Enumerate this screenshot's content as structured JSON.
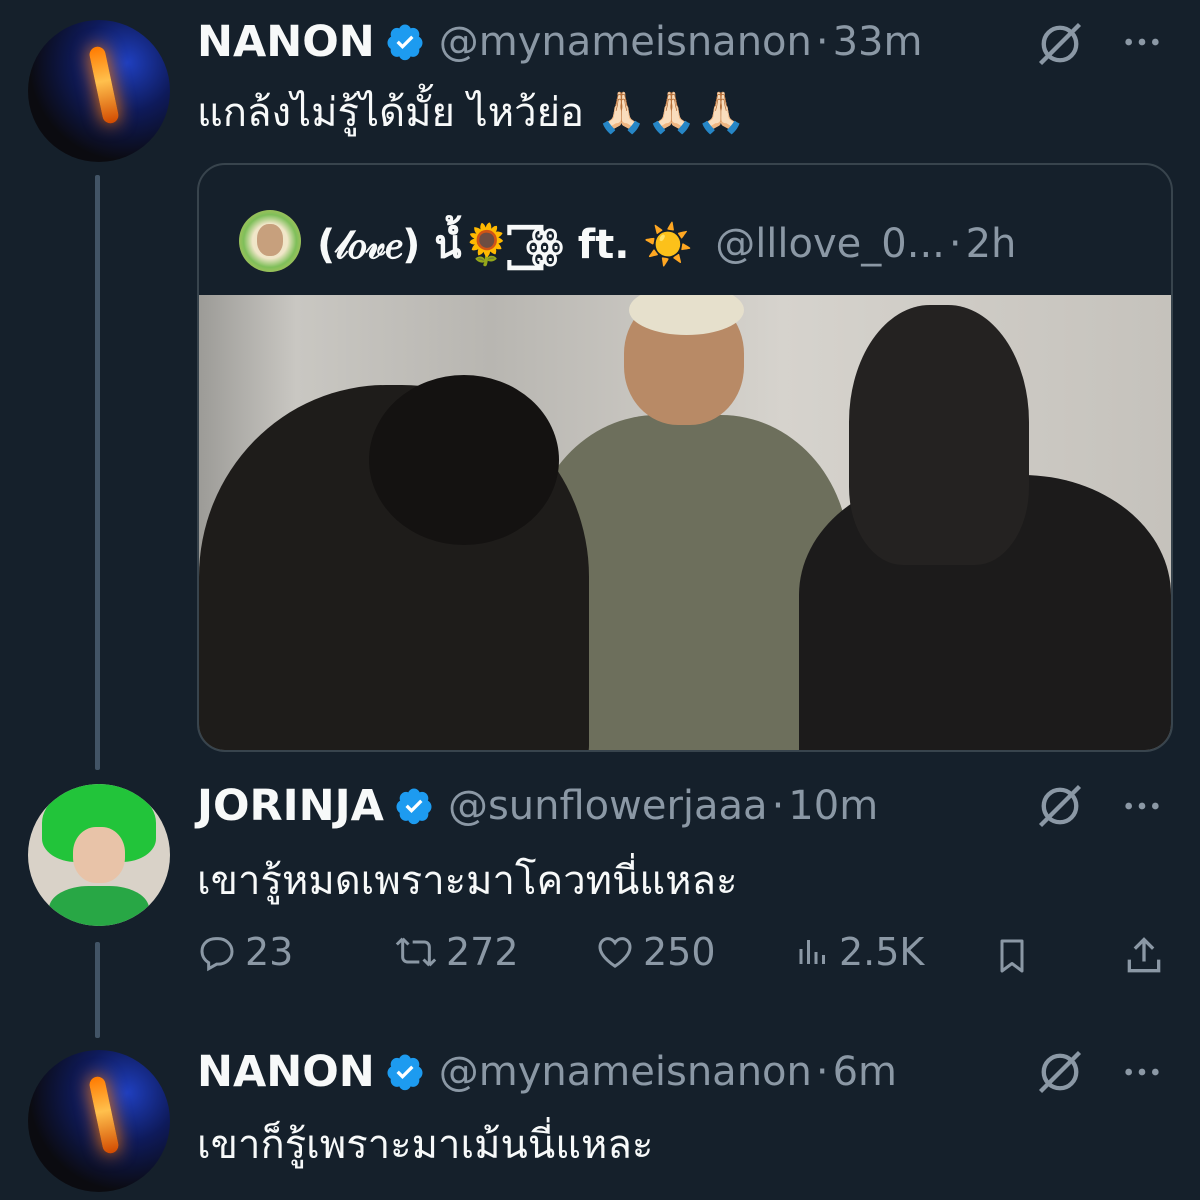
{
  "colors": {
    "background": "#15202b",
    "verified": "#1d9bf0",
    "muted": "#8b98a5",
    "text": "#f7f9f9"
  },
  "tweets": [
    {
      "name": "NANON",
      "handle": "@mynameisnanon",
      "time": "33m",
      "text": "แกล้งไม่รู้ได้มั้ย ไหว้ย่อ 🙏🏻🙏🏻🙏🏻",
      "quote": {
        "name": "(𝓁𝑜𝓋𝑒) นํ้🌻 ꙱ꙮ ft. ☀️",
        "handle": "@lllove_0...",
        "time": "2h"
      }
    },
    {
      "name": "JORINJA",
      "handle": "@sunflowerjaaa",
      "time": "10m",
      "text": "เขารู้หมดเพราะมาโควทนี่แหละ",
      "stats": {
        "replies": "23",
        "retweets": "272",
        "likes": "250",
        "views": "2.5K"
      }
    },
    {
      "name": "NANON",
      "handle": "@mynameisnanon",
      "time": "6m",
      "text": "เขาก็รู้เพราะมาเม้นนี่แหละ"
    }
  ]
}
